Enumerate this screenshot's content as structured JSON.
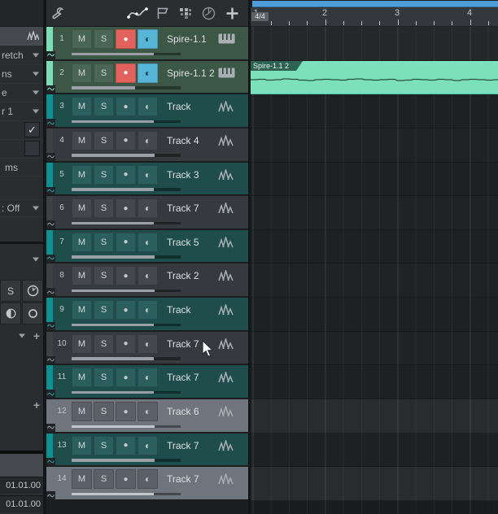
{
  "sidebar": {
    "rows": [
      {
        "label": "retch"
      },
      {
        "label": "ns"
      },
      {
        "label": "e"
      },
      {
        "label": "r 1"
      },
      {
        "label": "ms"
      },
      {
        "label": ": Off"
      }
    ],
    "checkbox_checked_glyph": "✓",
    "solo_button": "S",
    "icons": [
      "waveform-icon",
      "clock-icon",
      "monitor-icon",
      "record-circle-icon"
    ],
    "plus_label": "+",
    "timecodes": [
      "01.01.00",
      "01.01.00"
    ]
  },
  "toolbar": {
    "icons": [
      "wrench",
      "automation-curve",
      "marker-flag",
      "quantize-grid",
      "tempo-clock",
      "add-track"
    ]
  },
  "track_list": {
    "mute_label": "M",
    "solo_label": "S",
    "tracks": [
      {
        "num": "1",
        "name": "Spire-1.1",
        "theme": "green",
        "icon": "keyboard",
        "record_armed": true,
        "monitor_on": true,
        "level": 0.75
      },
      {
        "num": "2",
        "name": "Spire-1.1 2",
        "theme": "green",
        "icon": "keyboard",
        "record_armed": true,
        "monitor_on": true,
        "level": 0.58
      },
      {
        "num": "3",
        "name": "Track",
        "theme": "teal",
        "icon": "waveform",
        "record_armed": false,
        "monitor_on": false,
        "level": 0.75
      },
      {
        "num": "4",
        "name": "Track 4",
        "theme": "gray",
        "icon": "waveform",
        "record_armed": false,
        "monitor_on": false,
        "level": 0.76
      },
      {
        "num": "5",
        "name": "Track 3",
        "theme": "teal",
        "icon": "waveform",
        "record_armed": false,
        "monitor_on": false,
        "level": 0.75
      },
      {
        "num": "6",
        "name": "Track 7",
        "theme": "gray",
        "icon": "waveform",
        "record_armed": false,
        "monitor_on": false,
        "level": 0.75
      },
      {
        "num": "7",
        "name": "Track 5",
        "theme": "teal",
        "icon": "waveform",
        "record_armed": false,
        "monitor_on": false,
        "level": 0.76
      },
      {
        "num": "8",
        "name": "Track 2",
        "theme": "gray",
        "icon": "waveform",
        "record_armed": false,
        "monitor_on": false,
        "level": 0.76
      },
      {
        "num": "9",
        "name": "Track",
        "theme": "teal",
        "icon": "waveform",
        "record_armed": false,
        "monitor_on": false,
        "level": 0.75
      },
      {
        "num": "10",
        "name": "Track 7",
        "theme": "gray",
        "icon": "waveform",
        "record_armed": false,
        "monitor_on": false,
        "level": 0.75
      },
      {
        "num": "11",
        "name": "Track 7",
        "theme": "teal",
        "icon": "waveform",
        "record_armed": false,
        "monitor_on": false,
        "level": 0.75
      },
      {
        "num": "12",
        "name": "Track 6",
        "theme": "selected",
        "icon": "waveform",
        "record_armed": false,
        "monitor_on": false,
        "level": 0.76
      },
      {
        "num": "13",
        "name": "Track 7",
        "theme": "teal",
        "icon": "waveform",
        "record_armed": false,
        "monitor_on": false,
        "level": 0.76
      },
      {
        "num": "14",
        "name": "Track 7",
        "theme": "selected",
        "icon": "waveform",
        "record_armed": false,
        "monitor_on": false,
        "level": 0.75
      }
    ]
  },
  "timeline": {
    "time_signature": "4/4",
    "bar_numbers": [
      "1",
      "2",
      "3",
      "4"
    ],
    "clip": {
      "name": "Spire-1.1 2",
      "track_number": "2"
    }
  },
  "colors": {
    "accent_blue": "#4d9dd8",
    "clip_green": "#7be0bb",
    "record_red": "#e2635e",
    "monitor_blue": "#57b6d8",
    "strip_mint": "#7cdeb9",
    "strip_teal": "#0d9090"
  }
}
